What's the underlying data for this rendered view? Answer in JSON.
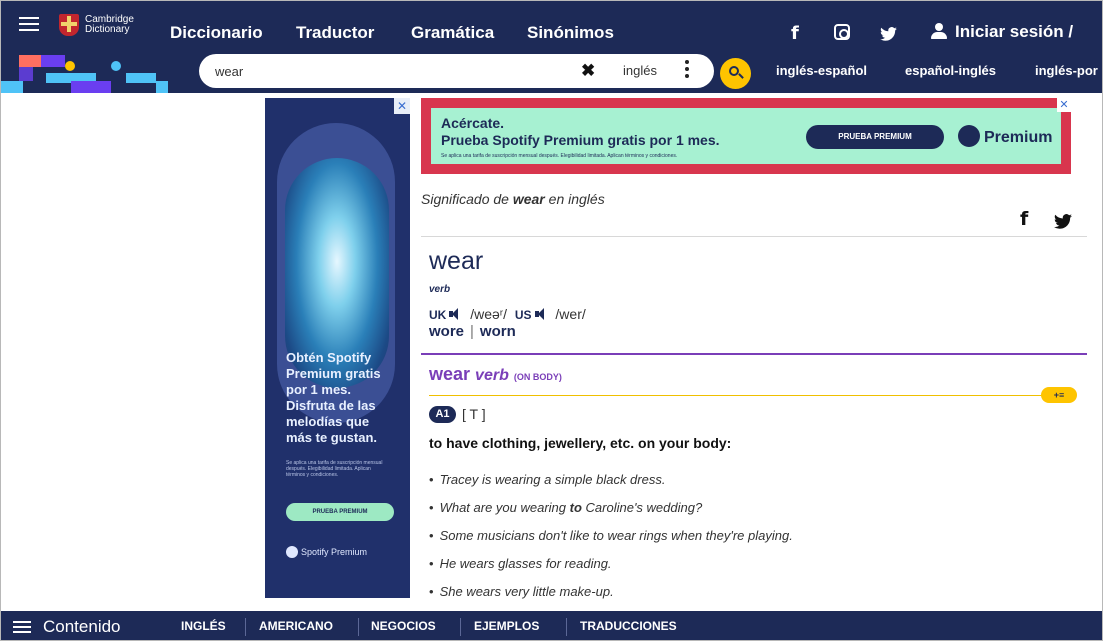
{
  "header": {
    "logo": {
      "line1": "Cambridge",
      "line2": "Dictionary"
    },
    "nav": [
      "Diccionario",
      "Traductor",
      "Gramática",
      "Sinónimos"
    ],
    "social": {
      "facebook": "f",
      "twitter": "✓"
    },
    "login_label": "Iniciar sesión /"
  },
  "search": {
    "query": "wear",
    "clear_glyph": "✖",
    "language": "inglés",
    "dict_links": [
      "inglés-español",
      "español-inglés",
      "inglés-por"
    ]
  },
  "ads": {
    "left": {
      "close": "✕",
      "headline": "Obtén Spotify Premium gratis por 1 mes. Disfruta de las melodías que más te gustan.",
      "fine_print": "Se aplica una tarifa de suscripción mensual después. Elegibilidad limitada. Aplican términos y condiciones.",
      "button": "PRUEBA PREMIUM",
      "brand": "Spotify Premium"
    },
    "top": {
      "close": "✕",
      "line1": "Acércate.",
      "line2": "Prueba Spotify Premium gratis por 1 mes.",
      "fine_print": "Se aplica una tarifa de suscripción mensual después. Elegibilidad limitada. Aplican términos y condiciones.",
      "button": "PRUEBA PREMIUM",
      "brand": "Premium"
    }
  },
  "entry": {
    "meaning_prefix": "Significado de ",
    "meaning_word": "wear",
    "meaning_suffix": " en inglés",
    "headword": "wear",
    "pos": "verb",
    "uk_label": "UK",
    "uk_ipa": "/weəʳ/",
    "us_label": "US",
    "us_ipa": "/wer/",
    "inflections": [
      "wore",
      "worn"
    ],
    "inflection_sep": "|",
    "sense": {
      "word": "wear",
      "pos": "verb",
      "guide": "(ON BODY)",
      "plus_label": "+≡",
      "level": "A1",
      "grammar": "[ T ]",
      "definition": "to have clothing, jewellery, etc. on your body:",
      "examples": [
        {
          "pre": "Tracey is wearing a simple black dress.",
          "bold": "",
          "post": ""
        },
        {
          "pre": "What are you wearing ",
          "bold": "to",
          "post": " Caroline's wedding?"
        },
        {
          "pre": "Some musicians don't like to wear rings when they're playing.",
          "bold": "",
          "post": ""
        },
        {
          "pre": "He wears glasses for reading.",
          "bold": "",
          "post": ""
        },
        {
          "pre": "She wears very little make-up.",
          "bold": "",
          "post": ""
        }
      ]
    }
  },
  "footer": {
    "title": "Contenido",
    "tabs": [
      "INGLÉS",
      "AMERICANO",
      "NEGOCIOS",
      "EJEMPLOS",
      "TRADUCCIONES"
    ]
  },
  "colors": {
    "navy": "#1d2a57",
    "accent_yellow": "#fec400",
    "sense_purple": "#7a3eb8"
  }
}
